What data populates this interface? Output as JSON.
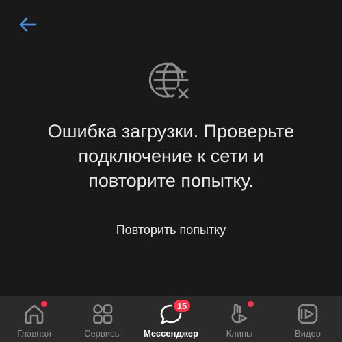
{
  "colors": {
    "background": "#19191a",
    "tabbar_background": "#2b2b2c",
    "accent": "#4b8fd9",
    "text": "#e8e8e8",
    "inactive": "#8c8c8e",
    "notification": "#ff3347"
  },
  "header": {
    "back_icon": "arrow-left-icon"
  },
  "error": {
    "icon": "globe-offline-icon",
    "message": "Ошибка загрузки. Проверьте подключение к сети и повторите попытку.",
    "retry_label": "Повторить попытку"
  },
  "tabbar": {
    "tabs": [
      {
        "label": "Главная",
        "icon": "home-icon",
        "active": false,
        "has_dot": true
      },
      {
        "label": "Сервисы",
        "icon": "services-grid-icon",
        "active": false,
        "has_dot": false
      },
      {
        "label": "Мессенджер",
        "icon": "chat-bubble-icon",
        "active": true,
        "badge": "15"
      },
      {
        "label": "Клипы",
        "icon": "clips-icon",
        "active": false,
        "has_dot": true
      },
      {
        "label": "Видео",
        "icon": "video-play-icon",
        "active": false,
        "has_dot": false
      }
    ]
  }
}
